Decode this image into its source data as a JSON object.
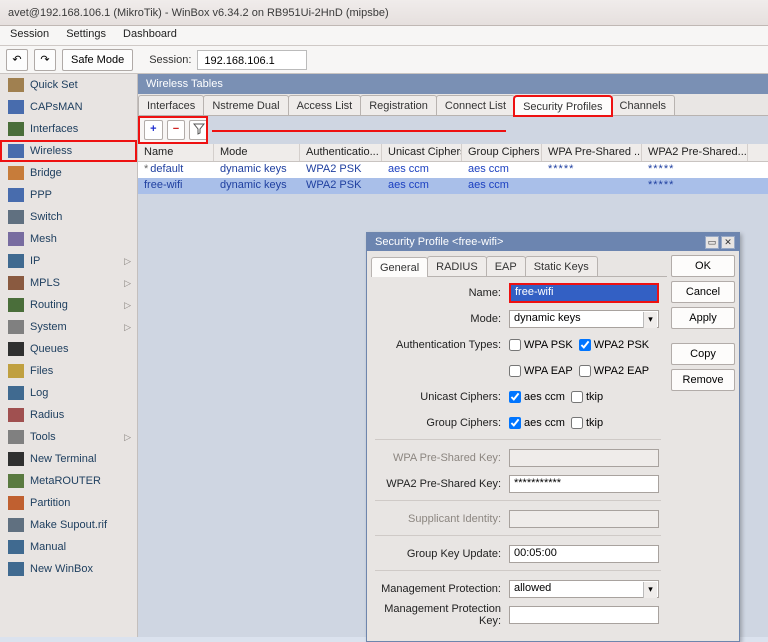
{
  "window": {
    "title": "avet@192.168.106.1 (MikroTik) - WinBox v6.34.2 on RB951Ui-2HnD (mipsbe)"
  },
  "menu": {
    "items": [
      "Session",
      "Settings",
      "Dashboard"
    ]
  },
  "toolbar": {
    "undo": "↶",
    "redo": "↷",
    "safe_mode": "Safe Mode",
    "session_label": "Session:",
    "session_value": "192.168.106.1"
  },
  "sidebar": {
    "items": [
      {
        "label": "Quick Set",
        "icon": "#a08050"
      },
      {
        "label": "CAPsMAN",
        "icon": "#486cad"
      },
      {
        "label": "Interfaces",
        "icon": "#4a6e3a"
      },
      {
        "label": "Wireless",
        "icon": "#486cad",
        "highlight": true
      },
      {
        "label": "Bridge",
        "icon": "#c77c3a"
      },
      {
        "label": "PPP",
        "icon": "#486cad"
      },
      {
        "label": "Switch",
        "icon": "#607080"
      },
      {
        "label": "Mesh",
        "icon": "#786ca0"
      },
      {
        "label": "IP",
        "icon": "#406a90",
        "expand": true
      },
      {
        "label": "MPLS",
        "icon": "#8a5a40",
        "expand": true
      },
      {
        "label": "Routing",
        "icon": "#4a6e3a",
        "expand": true
      },
      {
        "label": "System",
        "icon": "#808080",
        "expand": true
      },
      {
        "label": "Queues",
        "icon": "#303030"
      },
      {
        "label": "Files",
        "icon": "#c0a040"
      },
      {
        "label": "Log",
        "icon": "#406a90"
      },
      {
        "label": "Radius",
        "icon": "#a05050"
      },
      {
        "label": "Tools",
        "icon": "#808080",
        "expand": true
      },
      {
        "label": "New Terminal",
        "icon": "#303030"
      },
      {
        "label": "MetaROUTER",
        "icon": "#5a7a40"
      },
      {
        "label": "Partition",
        "icon": "#c06030"
      },
      {
        "label": "Make Supout.rif",
        "icon": "#607080"
      },
      {
        "label": "Manual",
        "icon": "#406a90"
      },
      {
        "label": "New WinBox",
        "icon": "#406a90"
      }
    ]
  },
  "wireless": {
    "panel_title": "Wireless Tables",
    "tabs": [
      "Interfaces",
      "Nstreme Dual",
      "Access List",
      "Registration",
      "Connect List",
      "Security Profiles",
      "Channels"
    ],
    "active_tab": 5,
    "columns": [
      "Name",
      "Mode",
      "Authenticatio...",
      "Unicast Ciphers",
      "Group Ciphers",
      "WPA Pre-Shared ...",
      "WPA2 Pre-Shared..."
    ],
    "rows": [
      {
        "name": "default",
        "mode": "dynamic keys",
        "auth": "WPA2 PSK",
        "uni": "aes ccm",
        "grp": "aes ccm",
        "wpa": "*****",
        "wpa2": "*****",
        "selected": false,
        "star": true
      },
      {
        "name": "free-wifi",
        "mode": "dynamic keys",
        "auth": "WPA2 PSK",
        "uni": "aes ccm",
        "grp": "aes ccm",
        "wpa": "",
        "wpa2": "*****",
        "selected": true
      }
    ],
    "plus": "+",
    "minus": "−"
  },
  "dialog": {
    "title": "Security Profile <free-wifi>",
    "tabs": [
      "General",
      "RADIUS",
      "EAP",
      "Static Keys"
    ],
    "active_tab": 0,
    "buttons": {
      "ok": "OK",
      "cancel": "Cancel",
      "apply": "Apply",
      "copy": "Copy",
      "remove": "Remove"
    },
    "form": {
      "name_label": "Name:",
      "name_value": "free-wifi",
      "mode_label": "Mode:",
      "mode_value": "dynamic keys",
      "auth_label": "Authentication Types:",
      "cb": {
        "wpa_psk": "WPA PSK",
        "wpa2_psk": "WPA2 PSK",
        "wpa_eap": "WPA EAP",
        "wpa2_eap": "WPA2 EAP"
      },
      "uni_label": "Unicast Ciphers:",
      "aes": "aes ccm",
      "tkip": "tkip",
      "grp_label": "Group Ciphers:",
      "wpa_key_label": "WPA Pre-Shared Key:",
      "wpa_key_value": "",
      "wpa2_key_label": "WPA2 Pre-Shared Key:",
      "wpa2_key_value": "***********",
      "supp_label": "Supplicant Identity:",
      "supp_value": "",
      "gku_label": "Group Key Update:",
      "gku_value": "00:05:00",
      "mp_label": "Management Protection:",
      "mp_value": "allowed",
      "mpk_label": "Management Protection Key:",
      "mpk_value": ""
    }
  }
}
